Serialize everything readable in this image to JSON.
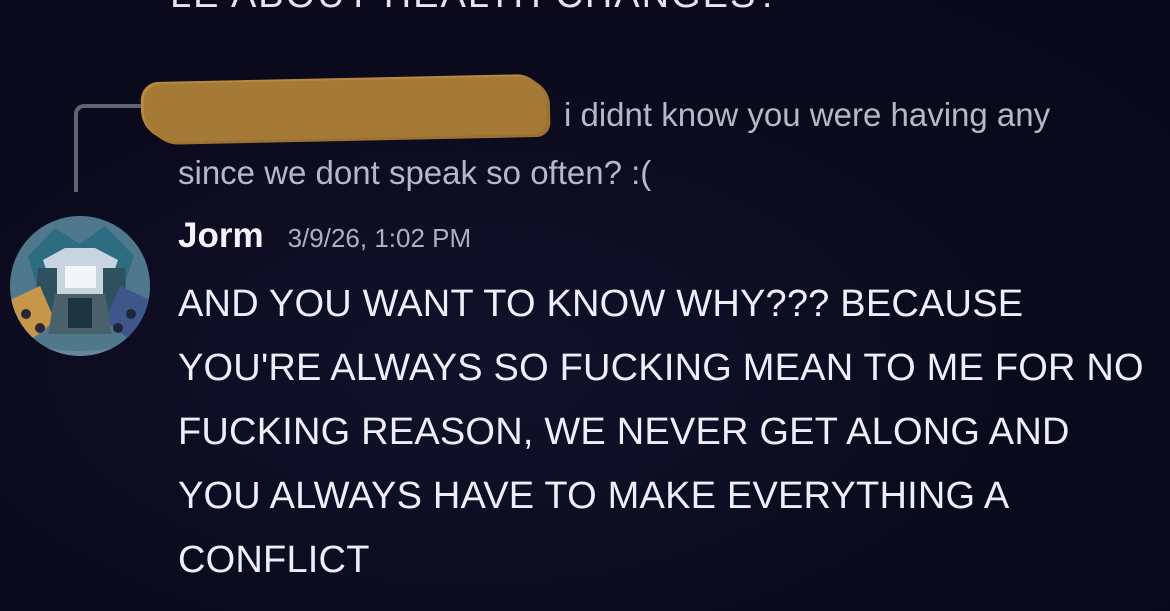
{
  "top_partial_message": "LE ABOUT HEALTH CHANGES? ",
  "reply": {
    "text": "i didnt know you were having any since we dont speak so often? :("
  },
  "message": {
    "author": "Jorm",
    "timestamp": "3/9/26, 1:02 PM",
    "text": "AND YOU WANT TO KNOW WHY??? BECAUSE YOU'RE ALWAYS SO FUCKING MEAN TO ME FOR NO FUCKING REASON, WE NEVER GET ALONG AND YOU ALWAYS HAVE TO MAKE EVERYTHING A CONFLICT"
  },
  "colors": {
    "background": "#0b0a1d",
    "redaction": "#a57a36"
  }
}
